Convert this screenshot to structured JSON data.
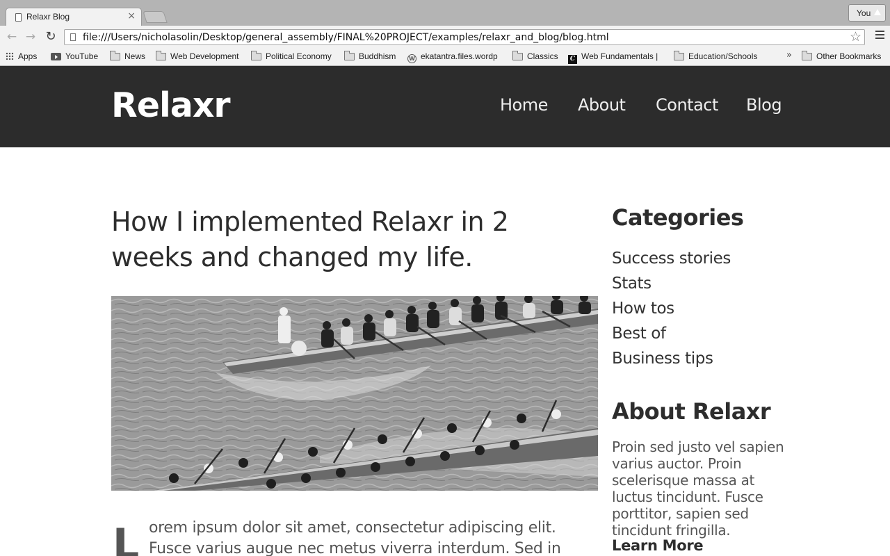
{
  "browser": {
    "tab_title": "Relaxr Blog",
    "tab_close_icon": "×",
    "profile_label": "You",
    "url": "file:///Users/nicholasolin/Desktop/general_assembly/FINAL%20PROJECT/examples/relaxr_and_blog/blog.html",
    "bookmarks": [
      {
        "label": "Apps",
        "icon": "apps-grid-icon"
      },
      {
        "label": "YouTube",
        "icon": "youtube-icon"
      },
      {
        "label": "News",
        "icon": "folder-icon"
      },
      {
        "label": "Web Development",
        "icon": "folder-icon"
      },
      {
        "label": "Political Economy",
        "icon": "folder-icon"
      },
      {
        "label": "Buddhism",
        "icon": "folder-icon"
      },
      {
        "label": "ekatantra.files.wordp",
        "icon": "wordpress-icon"
      },
      {
        "label": "Classics",
        "icon": "folder-icon"
      },
      {
        "label": "Web Fundamentals |",
        "icon": "codeweb-icon"
      },
      {
        "label": "Education/Schools",
        "icon": "folder-icon"
      },
      {
        "label": "Other Bookmarks",
        "icon": "folder-icon"
      }
    ],
    "bookmarks_overflow": "»"
  },
  "site": {
    "logo": "Relaxr",
    "nav": [
      "Home",
      "About",
      "Contact",
      "Blog"
    ]
  },
  "post": {
    "title": "How I implemented Relaxr in 2 weeks and changed my life.",
    "image_alt": "Dragon boat racing crews paddling",
    "dropcap": "L",
    "lead_text": "orem ipsum dolor sit amet, consectetur adipiscing elit. Fusce varius augue nec metus viverra interdum. Sed in"
  },
  "sidebar": {
    "categories_heading": "Categories",
    "categories": [
      "Success stories",
      "Stats",
      "How tos",
      "Best of",
      "Business tips"
    ],
    "about_heading": "About Relaxr",
    "about_text": "Proin sed justo vel sapien varius auctor. Proin scelerisque massa at luctus tincidunt. Fusce porttitor, sapien sed tincidunt fringilla.",
    "learn_more": "Learn More"
  },
  "colors": {
    "header_bg": "#2c2c2c",
    "heading_text": "#2d2d2d",
    "body_text": "#555555"
  }
}
